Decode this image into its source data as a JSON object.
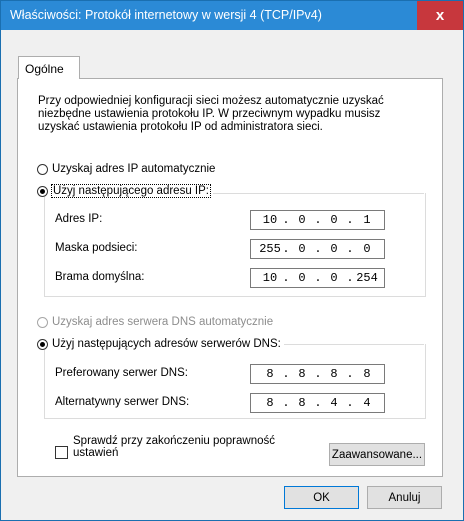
{
  "window": {
    "title": "Właściwości: Protokół internetowy w wersji 4 (TCP/IPv4)",
    "close_label": "x"
  },
  "tabs": [
    {
      "label": "Ogólne"
    }
  ],
  "intro": "Przy odpowiedniej konfiguracji sieci możesz automatycznie uzyskać niezbędne ustawienia protokołu IP. W przeciwnym wypadku musisz uzyskać ustawienia protokołu IP od administratora sieci.",
  "ip": {
    "auto_label": "Uzyskaj adres IP automatycznie",
    "manual_label": "Użyj następującego adresu IP:",
    "fields": [
      {
        "label": "Adres IP:",
        "octets": [
          "10",
          "0",
          "0",
          "1"
        ]
      },
      {
        "label": "Maska podsieci:",
        "octets": [
          "255",
          "0",
          "0",
          "0"
        ]
      },
      {
        "label": "Brama domyślna:",
        "octets": [
          "10",
          "0",
          "0",
          "254"
        ]
      }
    ]
  },
  "dns": {
    "auto_label": "Uzyskaj adres serwera DNS automatycznie",
    "manual_label": "Użyj następujących adresów serwerów DNS:",
    "fields": [
      {
        "label": "Preferowany serwer DNS:",
        "octets": [
          "8",
          "8",
          "8",
          "8"
        ]
      },
      {
        "label": "Alternatywny serwer DNS:",
        "octets": [
          "8",
          "8",
          "4",
          "4"
        ]
      }
    ]
  },
  "validate_label": "Sprawdź przy zakończeniu poprawność ustawień",
  "advanced_label": "Zaawansowane...",
  "ok_label": "OK",
  "cancel_label": "Anuluj",
  "colors": {
    "titlebar": "#2b8ad6",
    "close": "#c7373d",
    "focus_border": "#0078d7"
  }
}
